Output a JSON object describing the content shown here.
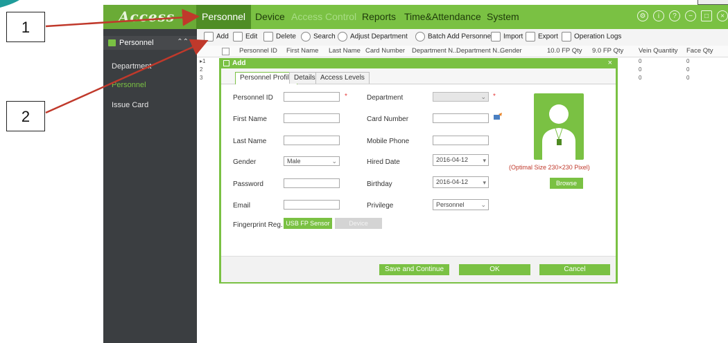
{
  "callouts": {
    "one": "1",
    "two": "2"
  },
  "app": {
    "logo_text": "Access"
  },
  "topnav": {
    "items": [
      {
        "label": "Personnel",
        "active": true
      },
      {
        "label": "Device"
      },
      {
        "label": "Access Control"
      },
      {
        "label": "Reports"
      },
      {
        "label": "Time&Attendance"
      },
      {
        "label": "System"
      }
    ],
    "icons": [
      "gear-icon",
      "info-icon",
      "help-icon",
      "minus-icon",
      "window-icon",
      "close-icon"
    ]
  },
  "sidebar": {
    "header": "Personnel",
    "items": [
      {
        "label": "Department"
      },
      {
        "label": "Personnel",
        "active": true
      },
      {
        "label": "Issue Card"
      }
    ]
  },
  "toolbar": {
    "buttons": [
      "Add",
      "Edit",
      "Delete",
      "Search",
      "Adjust Department",
      "Batch Add Personnel",
      "Import",
      "Export",
      "Operation Logs"
    ]
  },
  "table": {
    "columns": [
      "Personnel ID",
      "First Name",
      "Last Name",
      "Card Number",
      "Department N...",
      "Department N...",
      "Gender",
      "10.0 FP Qty",
      "9.0 FP Qty",
      "Vein Quantity",
      "Face Qty"
    ],
    "rows": [
      {
        "num": "1",
        "vein": "0",
        "face": "0"
      },
      {
        "num": "2",
        "vein": "0",
        "face": "0"
      },
      {
        "num": "3",
        "vein": "0",
        "face": "0"
      }
    ]
  },
  "dialog": {
    "title": "Add",
    "close": "×",
    "tabs": [
      "Personnel Profile",
      "Details",
      "Access Levels"
    ],
    "fields": {
      "personnel_id": "Personnel ID",
      "first_name": "First Name",
      "last_name": "Last Name",
      "gender": "Gender",
      "gender_value": "Male",
      "password": "Password",
      "email": "Email",
      "fingerprint": "Fingerprint Reg.",
      "department": "Department",
      "card_number": "Card Number",
      "mobile_phone": "Mobile Phone",
      "hired_date": "Hired Date",
      "hired_date_value": "2016-04-12",
      "birthday": "Birthday",
      "birthday_value": "2016-04-12",
      "privilege": "Privilege",
      "privilege_value": "Personnel",
      "required_mark": "*"
    },
    "buttons": {
      "usb_fp_sensor": "USB FP Sensor",
      "device": "Device",
      "browse": "Browse",
      "save_continue": "Save and Continue",
      "ok": "OK",
      "cancel": "Cancel"
    },
    "photo_hint": "(Optimal Size 230×230 Pixel)"
  },
  "colors": {
    "brand_green": "#7ac143",
    "nav_active": "#4f8d25",
    "sidebar_bg": "#3b3e41",
    "annotation_red": "#c0392b",
    "required_red": "#e63b3b"
  }
}
